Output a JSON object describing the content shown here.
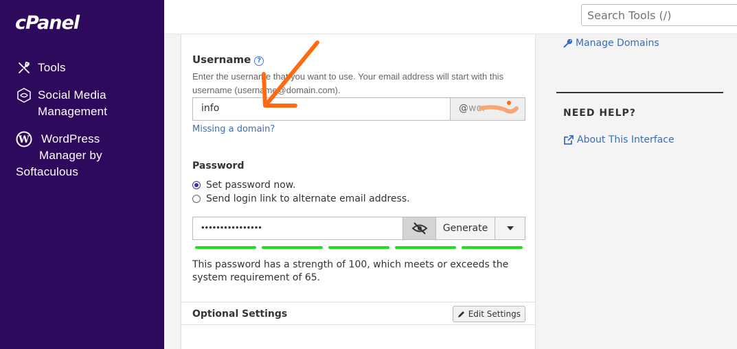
{
  "sidebar": {
    "logo": "cPanel",
    "items": [
      {
        "label": "Tools"
      },
      {
        "label_line1": "Social Media",
        "label_line2": "Management"
      },
      {
        "label_line1": "WordPress",
        "label_line2": "Manager by",
        "label_line3": "Softaculous"
      }
    ]
  },
  "header": {
    "search_placeholder": "Search Tools (/)"
  },
  "form": {
    "username_label": "Username",
    "username_help_icon": "question-circle-icon",
    "username_desc": "Enter the username that you want to use. Your email address will start with this username (username@domain.com).",
    "username_value": "info",
    "domain_addon": "@wor",
    "missing_domain": "Missing a domain?",
    "password_label": "Password",
    "radio_set_now": "Set password now.",
    "radio_send_link": "Send login link to alternate email address.",
    "password_value": "••••••••••••••••",
    "generate_label": "Generate",
    "strength_segments": 5,
    "strength_text": "This password has a strength of 100, which meets or exceeds the system requirement of 65.",
    "optional_title": "Optional Settings",
    "edit_settings": "Edit Settings"
  },
  "right": {
    "manage_domains": "Manage Domains",
    "need_help": "NEED HELP?",
    "about_interface": "About This Interface"
  },
  "colors": {
    "sidebar_bg": "#2d0a5b",
    "link": "#3a6db5",
    "strength_green": "#1ee01e",
    "annotation_orange": "#ff6a13"
  }
}
